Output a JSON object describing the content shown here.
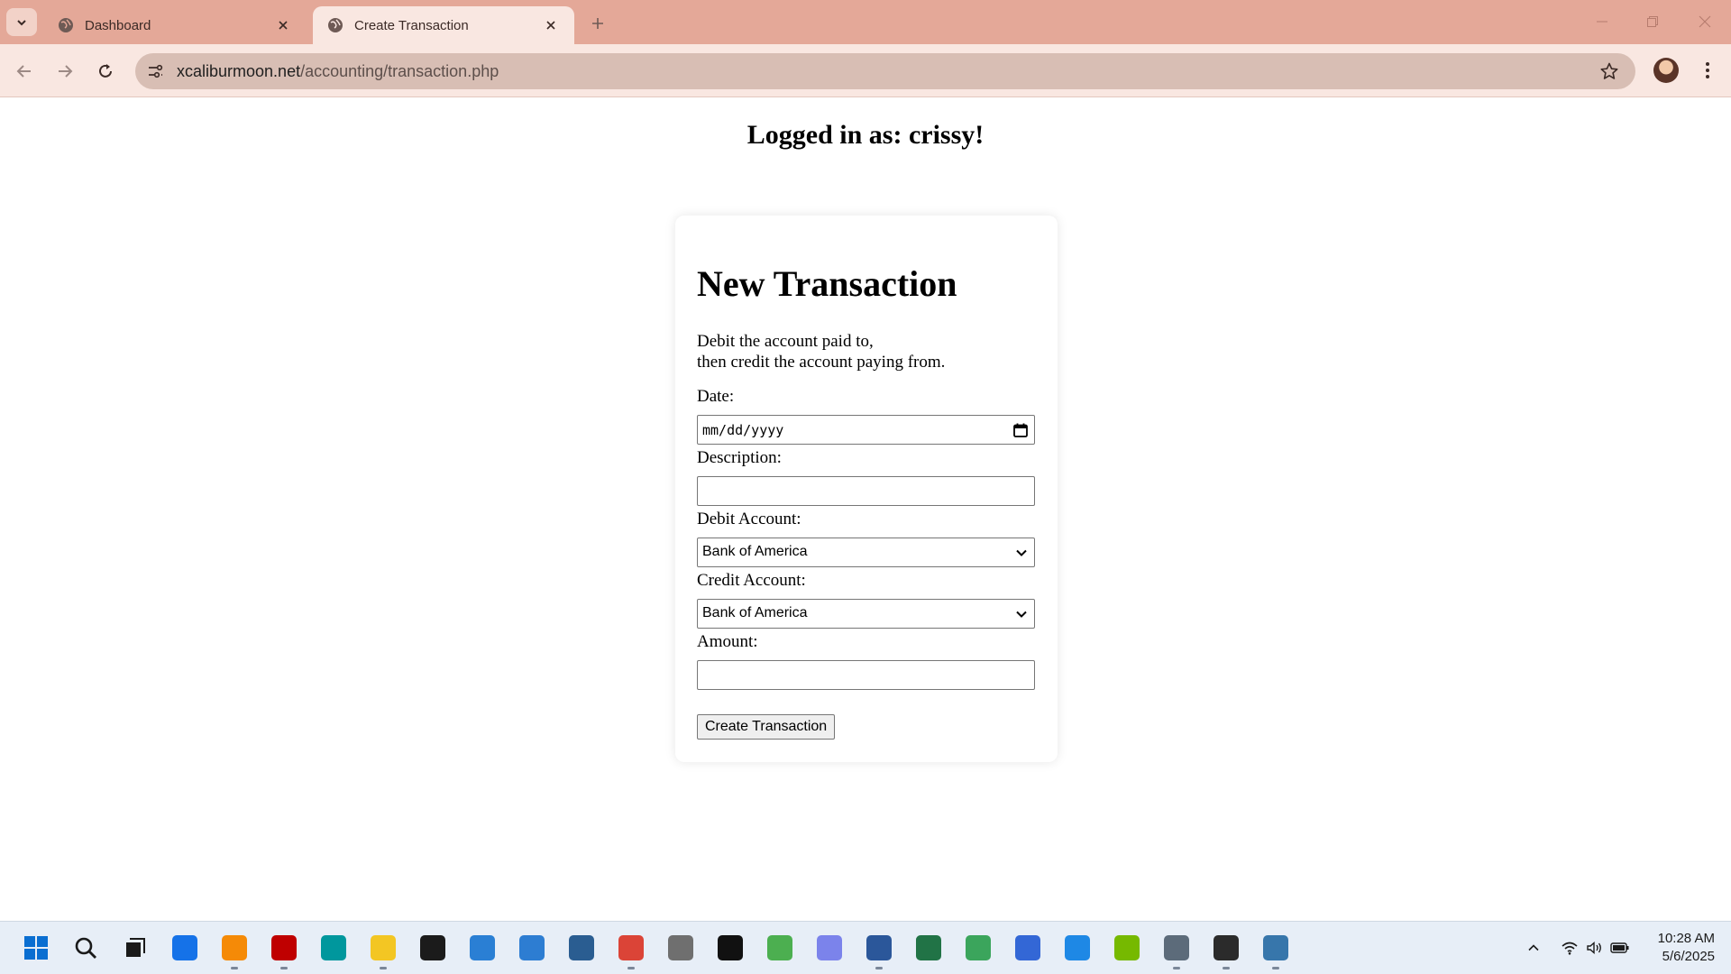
{
  "browser": {
    "tabs": [
      {
        "title": "Dashboard",
        "active": false
      },
      {
        "title": "Create Transaction",
        "active": true
      }
    ],
    "url_host": "xcaliburmoon.net",
    "url_path": "/accounting/transaction.php"
  },
  "page": {
    "logged_in_text": "Logged in as: crissy!",
    "form": {
      "heading": "New Transaction",
      "instruction_line1": "Debit the account paid to,",
      "instruction_line2": "then credit the account paying from.",
      "date_label": "Date:",
      "date_placeholder": "mm/dd/yyyy",
      "description_label": "Description:",
      "description_value": "",
      "debit_label": "Debit Account:",
      "debit_selected": "Bank of America",
      "credit_label": "Credit Account:",
      "credit_selected": "Bank of America",
      "amount_label": "Amount:",
      "amount_value": "",
      "submit_label": "Create Transaction"
    }
  },
  "taskbar": {
    "apps": [
      {
        "name": "start-icon",
        "color": "#0a6ed1"
      },
      {
        "name": "search-icon",
        "color": "#1a1a1a"
      },
      {
        "name": "task-view-icon",
        "color": "#1a1a1a"
      },
      {
        "name": "firefox-browser-icon",
        "color": "#1572e8"
      },
      {
        "name": "sublime-text-icon",
        "color": "#f58a07"
      },
      {
        "name": "filezilla-icon",
        "color": "#bf0000"
      },
      {
        "name": "arduino-icon",
        "color": "#00979d"
      },
      {
        "name": "file-explorer-icon",
        "color": "#f3c623"
      },
      {
        "name": "command-prompt-icon",
        "color": "#1b1b1b"
      },
      {
        "name": "notepad-icon",
        "color": "#2a7fd4"
      },
      {
        "name": "snipping-tool-icon",
        "color": "#2d7dd2"
      },
      {
        "name": "mysql-workbench-icon",
        "color": "#2a5d91"
      },
      {
        "name": "chrome-icon",
        "color": "#db4437"
      },
      {
        "name": "twitch-icon",
        "color": "#6f6f6f"
      },
      {
        "name": "unity-icon",
        "color": "#111111"
      },
      {
        "name": "paint-icon",
        "color": "#4caf50"
      },
      {
        "name": "teams-icon",
        "color": "#7b83eb"
      },
      {
        "name": "word-icon",
        "color": "#2b579a"
      },
      {
        "name": "excel-icon",
        "color": "#217346"
      },
      {
        "name": "sync-icon",
        "color": "#3ba55c"
      },
      {
        "name": "network-icon",
        "color": "#3367d6"
      },
      {
        "name": "rapid-icon",
        "color": "#1e88e5"
      },
      {
        "name": "nvidia-icon",
        "color": "#76b900"
      },
      {
        "name": "calculator-icon",
        "color": "#5c6b7a"
      },
      {
        "name": "terminal-icon",
        "color": "#2b2b2b"
      },
      {
        "name": "python-icon",
        "color": "#3776ab"
      }
    ],
    "clock_time": "10:28 AM",
    "clock_date": "5/6/2025"
  }
}
